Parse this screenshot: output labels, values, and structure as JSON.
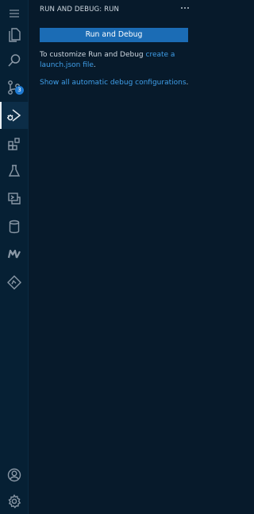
{
  "sidebar": {
    "title": "RUN AND DEBUG: RUN",
    "more_actions": "···",
    "run_button": "Run and Debug",
    "info_prefix": "To customize Run and Debug",
    "info_link": "create a launch.json file",
    "info_suffix": ".",
    "show_link": "Show all automatic debug configurations",
    "show_suffix": "."
  },
  "activity_bar": {
    "source_control_badge": "3",
    "items": [
      "menu-icon",
      "explorer-icon",
      "search-icon",
      "source-control-icon",
      "run-debug-icon",
      "extensions-icon",
      "testing-icon",
      "remote-explorer-icon",
      "database-icon",
      "markdown-icon",
      "deploy-icon",
      "account-icon",
      "settings-gear-icon"
    ]
  },
  "colors": {
    "background": "#071a2b",
    "activity_bar": "#062034",
    "button": "#1b6cb5",
    "link": "#3f9ee8",
    "badge": "#1f7ad1"
  }
}
